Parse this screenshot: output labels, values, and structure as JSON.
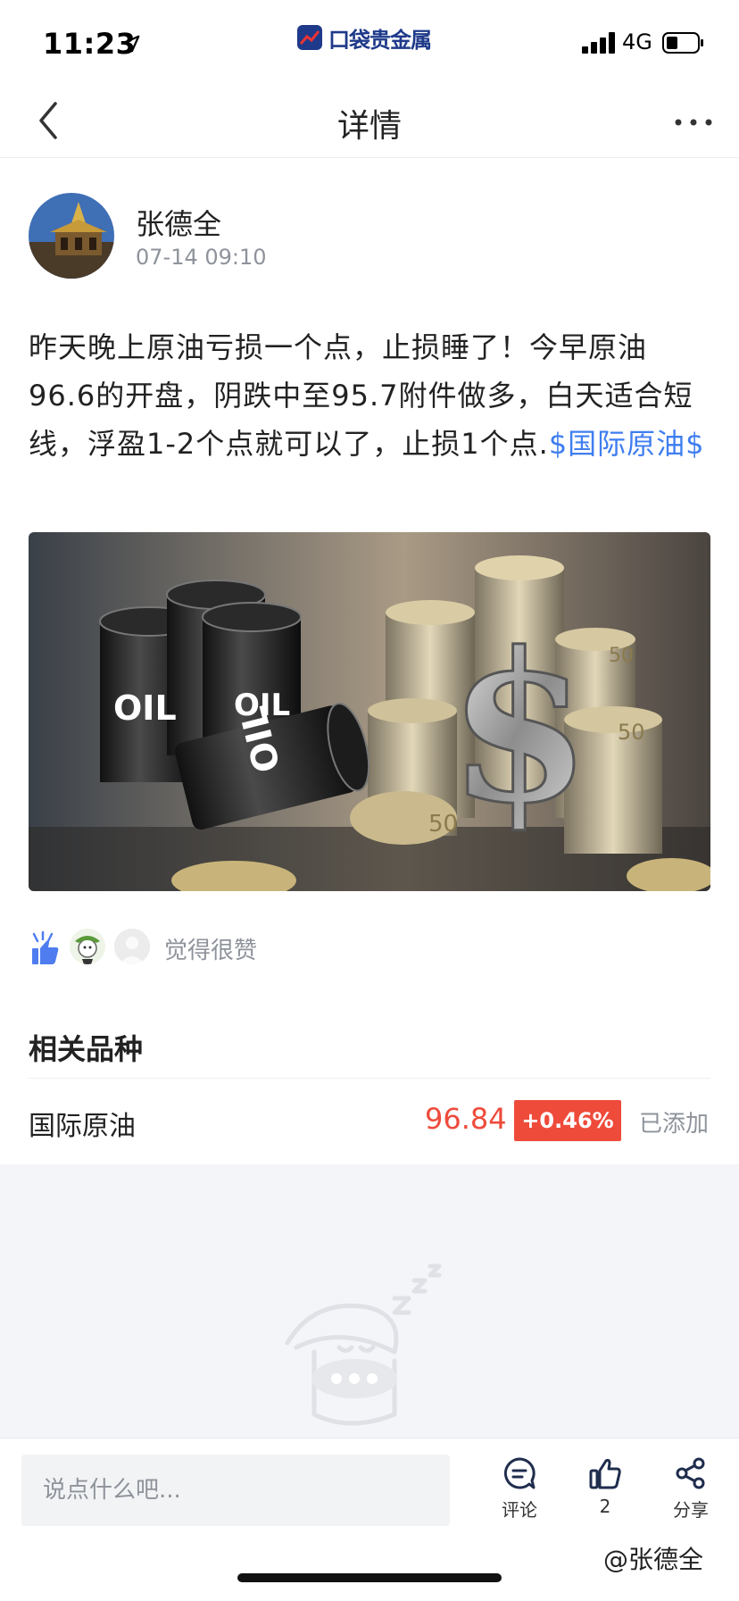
{
  "status_bar": {
    "time": "11:23",
    "brand": "口袋贵金属",
    "network": "4G"
  },
  "nav": {
    "title": "详情"
  },
  "post": {
    "author": "张德全",
    "time": "07-14 09:10",
    "body_text": "昨天晚上原油亏损一个点，止损睡了！今早原油96.6的开盘，阴跌中至95.7附件做多，白天适合短线，浮盈1-2个点就可以了，止损1个点.",
    "tag": "$国际原油$",
    "image_labels": [
      "OIL",
      "OIL",
      "OIL",
      "$",
      "50",
      "50",
      "50"
    ]
  },
  "likes": {
    "text": "觉得很赞"
  },
  "related": {
    "title": "相关品种",
    "items": [
      {
        "name": "国际原油",
        "price": "96.84",
        "change": "+0.46%",
        "status": "已添加"
      }
    ]
  },
  "bottom_bar": {
    "input_placeholder": "说点什么吧...",
    "comment_label": "评论",
    "like_count": "2",
    "share_label": "分享",
    "watermark": "@张德全"
  },
  "colors": {
    "accent_blue": "#3f7ef0",
    "price_red": "#ee4b3b",
    "muted_gray": "#8e939b",
    "empty_bg": "#f4f5f8"
  },
  "icons": [
    "location-arrow-icon",
    "brand-logo-icon",
    "signal-icon",
    "battery-icon",
    "back-chevron-icon",
    "more-dots-icon",
    "thumbs-up-icon",
    "comment-icon",
    "share-icon",
    "sleeping-mascot-icon"
  ]
}
